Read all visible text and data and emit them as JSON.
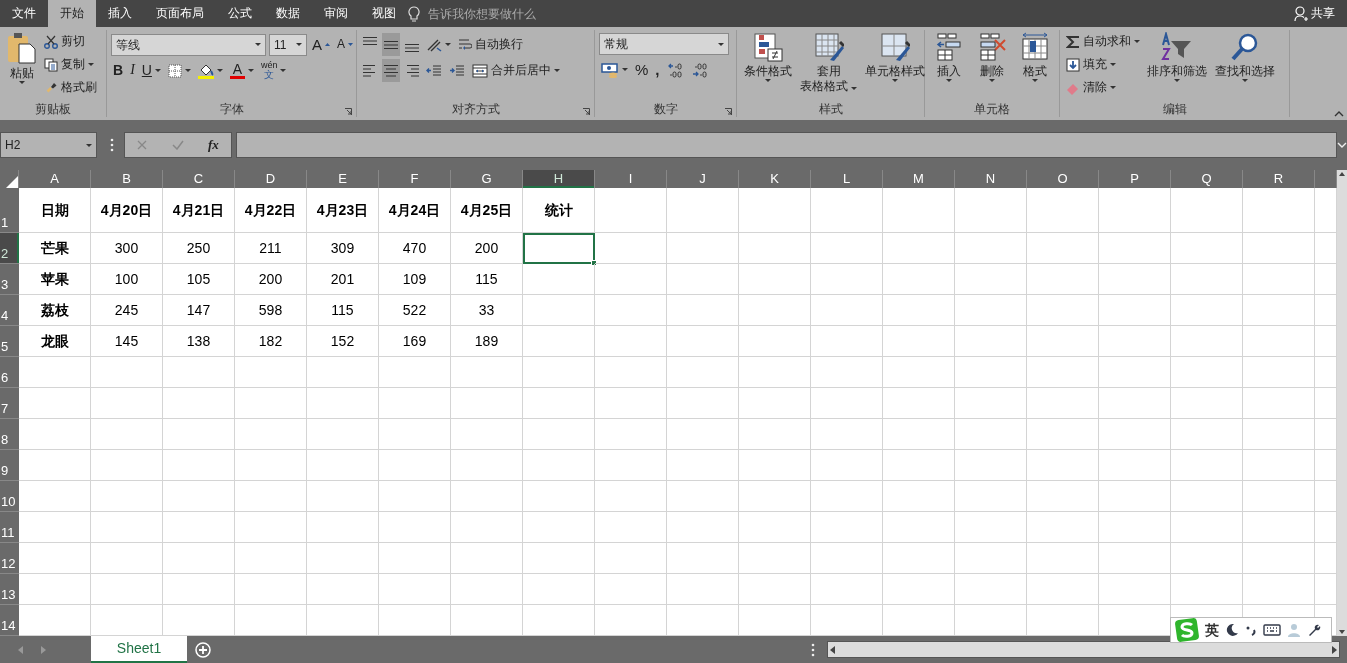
{
  "menu_tabs": [
    {
      "label": "文件",
      "selected": false
    },
    {
      "label": "开始",
      "selected": true
    },
    {
      "label": "插入",
      "selected": false
    },
    {
      "label": "页面布局",
      "selected": false
    },
    {
      "label": "公式",
      "selected": false
    },
    {
      "label": "数据",
      "selected": false
    },
    {
      "label": "审阅",
      "selected": false
    },
    {
      "label": "视图",
      "selected": false
    }
  ],
  "tell_me": "告诉我你想要做什么",
  "share": "共享",
  "ribbon": {
    "clipboard": {
      "label": "剪贴板",
      "paste": "粘贴",
      "cut": "剪切",
      "copy": "复制",
      "format_painter": "格式刷"
    },
    "font": {
      "label": "字体",
      "font_name": "等线",
      "font_size": "11",
      "grow": "A",
      "shrink": "A",
      "bold": "B",
      "italic": "I",
      "underline": "U",
      "font_color": "A",
      "phonetic_top": "wén",
      "phonetic_bottom": "文"
    },
    "alignment": {
      "label": "对齐方式",
      "wrap_text": "自动换行",
      "merge_center": "合并后居中",
      "vertical": [
        {
          "kind": "top",
          "selected": false
        },
        {
          "kind": "middle",
          "selected": true
        },
        {
          "kind": "bottom",
          "selected": false
        }
      ],
      "horizontal": [
        {
          "kind": "left",
          "selected": false
        },
        {
          "kind": "center",
          "selected": true
        },
        {
          "kind": "right",
          "selected": false
        }
      ]
    },
    "number": {
      "label": "数字",
      "format": "常规",
      "percent": "%",
      "comma": ","
    },
    "styles": {
      "label": "样式",
      "buttons": [
        {
          "kind": "conditional",
          "lines": [
            "条件格式"
          ]
        },
        {
          "kind": "table",
          "lines": [
            "套用",
            "表格格式"
          ]
        },
        {
          "kind": "cell",
          "lines": [
            "单元格样式"
          ]
        }
      ]
    },
    "cells": {
      "label": "单元格",
      "buttons": [
        {
          "kind": "insert",
          "label": "插入"
        },
        {
          "kind": "delete",
          "label": "删除"
        },
        {
          "kind": "format",
          "label": "格式"
        }
      ]
    },
    "editing": {
      "label": "编辑",
      "autosum": "自动求和",
      "fill": "填充",
      "clear": "清除",
      "sort_filter": "排序和筛选",
      "find_select": "查找和选择"
    }
  },
  "name_box": "H2",
  "fx": "fx",
  "columns": [
    {
      "label": "A",
      "selected": false
    },
    {
      "label": "B",
      "selected": false
    },
    {
      "label": "C",
      "selected": false
    },
    {
      "label": "D",
      "selected": false
    },
    {
      "label": "E",
      "selected": false
    },
    {
      "label": "F",
      "selected": false
    },
    {
      "label": "G",
      "selected": false
    },
    {
      "label": "H",
      "selected": true
    },
    {
      "label": "I",
      "selected": false
    },
    {
      "label": "J",
      "selected": false
    },
    {
      "label": "K",
      "selected": false
    },
    {
      "label": "L",
      "selected": false
    },
    {
      "label": "M",
      "selected": false
    },
    {
      "label": "N",
      "selected": false
    },
    {
      "label": "O",
      "selected": false
    },
    {
      "label": "P",
      "selected": false
    },
    {
      "label": "Q",
      "selected": false
    },
    {
      "label": "R",
      "selected": false
    }
  ],
  "rows": [
    {
      "label": "1",
      "selected": false,
      "cells": [
        "日期",
        "4月20日",
        "4月21日",
        "4月22日",
        "4月23日",
        "4月24日",
        "4月25日",
        "统计"
      ]
    },
    {
      "label": "2",
      "selected": true,
      "cells": [
        "芒果",
        "300",
        "250",
        "211",
        "309",
        "470",
        "200"
      ]
    },
    {
      "label": "3",
      "selected": false,
      "cells": [
        "苹果",
        "100",
        "105",
        "200",
        "201",
        "109",
        "115"
      ]
    },
    {
      "label": "4",
      "selected": false,
      "cells": [
        "荔枝",
        "245",
        "147",
        "598",
        "115",
        "522",
        "33"
      ]
    },
    {
      "label": "5",
      "selected": false,
      "cells": [
        "龙眼",
        "145",
        "138",
        "182",
        "152",
        "169",
        "189"
      ]
    },
    {
      "label": "6",
      "selected": false
    },
    {
      "label": "7",
      "selected": false
    },
    {
      "label": "8",
      "selected": false
    },
    {
      "label": "9",
      "selected": false
    },
    {
      "label": "10",
      "selected": false
    },
    {
      "label": "11",
      "selected": false
    },
    {
      "label": "12",
      "selected": false
    },
    {
      "label": "13",
      "selected": false
    },
    {
      "label": "14",
      "selected": false
    }
  ],
  "sheet_tabs": [
    {
      "label": "Sheet1",
      "selected": true
    }
  ],
  "ime": {
    "mode": "英"
  }
}
